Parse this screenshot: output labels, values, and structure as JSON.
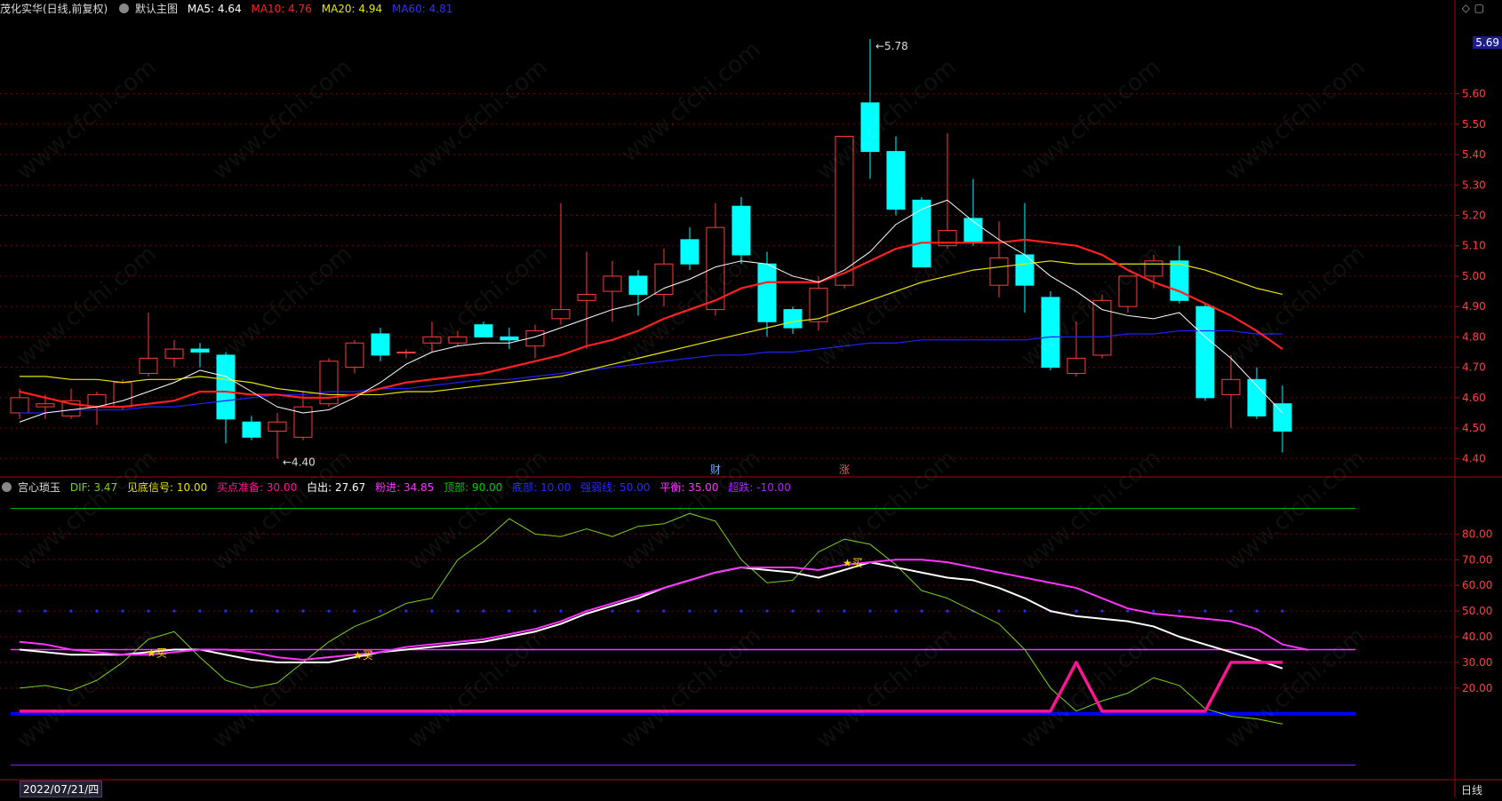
{
  "header_main": {
    "title": "茂化实华(日线,前复权)",
    "indicator_name": "默认主图",
    "ma5": "MA5: 4.64",
    "ma10": "MA10: 4.76",
    "ma20": "MA20: 4.94",
    "ma60": "MA60: 4.81"
  },
  "header_sub": {
    "indicator_name": "宫心琐玉",
    "dif": "DIF: 3.47",
    "signal_bottom": "见底信号: 10.00",
    "buy_ready": "买点准备: 30.00",
    "white_out": "白出: 27.67",
    "pink_in": "粉进: 34.85",
    "top": "顶部: 90.00",
    "bottom": "底部: 10.00",
    "strong_weak": "强弱线: 50.00",
    "balance": "平衡: 35.00",
    "oversold": "超跌: -10.00"
  },
  "last_price": "5.69",
  "date_label": "2022/07/21/四",
  "period_label": "日线",
  "colors": {
    "up": "#ff3c3c",
    "down": "#00ffff",
    "ma5": "#ffffff",
    "ma10": "#ff2020",
    "ma20": "#e6e600",
    "ma60": "#2020ff",
    "dif": "#7ad11c",
    "white": "#ffffff",
    "pink": "#ff33ff",
    "magenta": "#ff1493",
    "blue": "#0000ff",
    "green_line": "#00b000"
  },
  "watermark": "www.cfchi.com",
  "chart_data": [
    {
      "type": "candlestick",
      "title": "茂化实华(日线,前复权)",
      "ylim": [
        4.36,
        5.85
      ],
      "yticks": [
        "5.60",
        "5.50",
        "5.40",
        "5.30",
        "5.20",
        "5.10",
        "5.00",
        "4.90",
        "4.80",
        "4.70",
        "4.60",
        "4.50",
        "4.40"
      ],
      "candles": [
        {
          "o": 4.55,
          "h": 4.63,
          "l": 4.53,
          "c": 4.6
        },
        {
          "o": 4.57,
          "h": 4.61,
          "l": 4.53,
          "c": 4.58
        },
        {
          "o": 4.54,
          "h": 4.63,
          "l": 4.53,
          "c": 4.59
        },
        {
          "o": 4.57,
          "h": 4.62,
          "l": 4.51,
          "c": 4.61
        },
        {
          "o": 4.57,
          "h": 4.66,
          "l": 4.56,
          "c": 4.65
        },
        {
          "o": 4.68,
          "h": 4.88,
          "l": 4.67,
          "c": 4.73
        },
        {
          "o": 4.73,
          "h": 4.79,
          "l": 4.7,
          "c": 4.76
        },
        {
          "o": 4.76,
          "h": 4.78,
          "l": 4.7,
          "c": 4.75
        },
        {
          "o": 4.74,
          "h": 4.75,
          "l": 4.45,
          "c": 4.53
        },
        {
          "o": 4.52,
          "h": 4.54,
          "l": 4.46,
          "c": 4.47
        },
        {
          "o": 4.49,
          "h": 4.55,
          "l": 4.4,
          "c": 4.52
        },
        {
          "o": 4.47,
          "h": 4.62,
          "l": 4.46,
          "c": 4.57
        },
        {
          "o": 4.58,
          "h": 4.73,
          "l": 4.57,
          "c": 4.72
        },
        {
          "o": 4.7,
          "h": 4.79,
          "l": 4.68,
          "c": 4.78
        },
        {
          "o": 4.81,
          "h": 4.83,
          "l": 4.72,
          "c": 4.74
        },
        {
          "o": 4.75,
          "h": 4.76,
          "l": 4.73,
          "c": 4.75
        },
        {
          "o": 4.78,
          "h": 4.85,
          "l": 4.75,
          "c": 4.8
        },
        {
          "o": 4.78,
          "h": 4.82,
          "l": 4.77,
          "c": 4.8
        },
        {
          "o": 4.84,
          "h": 4.85,
          "l": 4.8,
          "c": 4.8
        },
        {
          "o": 4.8,
          "h": 4.83,
          "l": 4.76,
          "c": 4.79
        },
        {
          "o": 4.77,
          "h": 4.84,
          "l": 4.73,
          "c": 4.82
        },
        {
          "o": 4.86,
          "h": 5.24,
          "l": 4.84,
          "c": 4.89
        },
        {
          "o": 4.92,
          "h": 5.08,
          "l": 4.76,
          "c": 4.94
        },
        {
          "o": 4.95,
          "h": 5.05,
          "l": 4.85,
          "c": 5.0
        },
        {
          "o": 5.0,
          "h": 5.02,
          "l": 4.87,
          "c": 4.94
        },
        {
          "o": 4.94,
          "h": 5.09,
          "l": 4.9,
          "c": 5.04
        },
        {
          "o": 5.12,
          "h": 5.16,
          "l": 5.02,
          "c": 5.04
        },
        {
          "o": 4.89,
          "h": 5.24,
          "l": 4.87,
          "c": 5.16
        },
        {
          "o": 5.23,
          "h": 5.26,
          "l": 5.04,
          "c": 5.07
        },
        {
          "o": 5.04,
          "h": 5.08,
          "l": 4.8,
          "c": 4.85
        },
        {
          "o": 4.89,
          "h": 4.9,
          "l": 4.81,
          "c": 4.83
        },
        {
          "o": 4.85,
          "h": 5.0,
          "l": 4.82,
          "c": 4.96
        },
        {
          "o": 4.97,
          "h": 5.46,
          "l": 4.96,
          "c": 5.46
        },
        {
          "o": 5.57,
          "h": 5.78,
          "l": 5.32,
          "c": 5.41
        },
        {
          "o": 5.41,
          "h": 5.46,
          "l": 5.2,
          "c": 5.22
        },
        {
          "o": 5.25,
          "h": 5.26,
          "l": 5.03,
          "c": 5.03
        },
        {
          "o": 5.1,
          "h": 5.47,
          "l": 5.09,
          "c": 5.15
        },
        {
          "o": 5.19,
          "h": 5.32,
          "l": 5.1,
          "c": 5.11
        },
        {
          "o": 4.97,
          "h": 5.18,
          "l": 4.93,
          "c": 5.06
        },
        {
          "o": 5.07,
          "h": 5.24,
          "l": 4.88,
          "c": 4.97
        },
        {
          "o": 4.93,
          "h": 4.95,
          "l": 4.69,
          "c": 4.7
        },
        {
          "o": 4.68,
          "h": 4.85,
          "l": 4.67,
          "c": 4.73
        },
        {
          "o": 4.74,
          "h": 4.94,
          "l": 4.73,
          "c": 4.92
        },
        {
          "o": 4.9,
          "h": 5.0,
          "l": 4.88,
          "c": 5.0
        },
        {
          "o": 5.0,
          "h": 5.07,
          "l": 4.96,
          "c": 5.05
        },
        {
          "o": 5.05,
          "h": 5.1,
          "l": 4.91,
          "c": 4.92
        },
        {
          "o": 4.9,
          "h": 4.91,
          "l": 4.59,
          "c": 4.6
        },
        {
          "o": 4.61,
          "h": 4.74,
          "l": 4.5,
          "c": 4.66
        },
        {
          "o": 4.66,
          "h": 4.7,
          "l": 4.53,
          "c": 4.54
        },
        {
          "o": 4.58,
          "h": 4.64,
          "l": 4.42,
          "c": 4.49
        }
      ],
      "ma5": [
        4.52,
        4.55,
        4.56,
        4.57,
        4.59,
        4.62,
        4.65,
        4.69,
        4.67,
        4.62,
        4.57,
        4.55,
        4.56,
        4.6,
        4.65,
        4.71,
        4.75,
        4.77,
        4.78,
        4.78,
        4.8,
        4.83,
        4.86,
        4.89,
        4.91,
        4.96,
        4.99,
        5.03,
        5.05,
        5.04,
        5.0,
        4.98,
        5.02,
        5.08,
        5.17,
        5.22,
        5.25,
        5.18,
        5.12,
        5.07,
        5.0,
        4.95,
        4.89,
        4.87,
        4.86,
        4.88,
        4.8,
        4.73,
        4.64,
        4.55
      ],
      "ma10": [
        4.62,
        4.6,
        4.58,
        4.57,
        4.57,
        4.58,
        4.59,
        4.62,
        4.62,
        4.61,
        4.61,
        4.6,
        4.6,
        4.61,
        4.63,
        4.65,
        4.66,
        4.67,
        4.68,
        4.7,
        4.72,
        4.74,
        4.77,
        4.79,
        4.82,
        4.86,
        4.89,
        4.92,
        4.96,
        4.98,
        4.98,
        4.98,
        5.01,
        5.05,
        5.09,
        5.11,
        5.11,
        5.11,
        5.11,
        5.12,
        5.11,
        5.1,
        5.07,
        5.02,
        4.98,
        4.95,
        4.91,
        4.87,
        4.82,
        4.76
      ],
      "ma20": [
        4.67,
        4.67,
        4.66,
        4.66,
        4.65,
        4.66,
        4.66,
        4.67,
        4.66,
        4.65,
        4.63,
        4.62,
        4.61,
        4.61,
        4.61,
        4.62,
        4.62,
        4.63,
        4.64,
        4.65,
        4.66,
        4.67,
        4.69,
        4.71,
        4.73,
        4.75,
        4.77,
        4.79,
        4.81,
        4.83,
        4.85,
        4.86,
        4.89,
        4.92,
        4.95,
        4.98,
        5.0,
        5.02,
        5.03,
        5.04,
        5.05,
        5.04,
        5.04,
        5.04,
        5.04,
        5.04,
        5.02,
        4.99,
        4.96,
        4.94
      ],
      "ma60": [
        4.55,
        4.55,
        4.56,
        4.56,
        4.56,
        4.57,
        4.57,
        4.58,
        4.59,
        4.6,
        4.61,
        4.61,
        4.62,
        4.62,
        4.63,
        4.63,
        4.64,
        4.65,
        4.66,
        4.66,
        4.67,
        4.68,
        4.69,
        4.7,
        4.71,
        4.72,
        4.73,
        4.74,
        4.74,
        4.75,
        4.75,
        4.76,
        4.77,
        4.78,
        4.78,
        4.79,
        4.79,
        4.79,
        4.79,
        4.79,
        4.8,
        4.8,
        4.8,
        4.81,
        4.81,
        4.82,
        4.82,
        4.82,
        4.81,
        4.81
      ],
      "annotations": [
        {
          "label": "5.78",
          "index": 33,
          "value": 5.78
        },
        {
          "label": "4.40",
          "index": 10,
          "value": 4.4
        },
        {
          "label": "财",
          "index": 27
        },
        {
          "label": "涨",
          "index": 32
        }
      ]
    },
    {
      "type": "line",
      "title": "宫心琐玉",
      "ylim": [
        -15,
        95
      ],
      "yticks": [
        "80.00",
        "70.00",
        "60.00",
        "50.00",
        "40.00",
        "30.00",
        "20.00"
      ],
      "series": [
        {
          "name": "DIF",
          "values": [
            20,
            21,
            19,
            23,
            30,
            39,
            42,
            32,
            23,
            20,
            22,
            30,
            38,
            44,
            48,
            53,
            55,
            70,
            77,
            86,
            80,
            79,
            82,
            79,
            83,
            84,
            88,
            85,
            70,
            61,
            62,
            73,
            78,
            76,
            68,
            58,
            55,
            50,
            45,
            35,
            20,
            11,
            15,
            18,
            24,
            21,
            12,
            9,
            8,
            6
          ]
        },
        {
          "name": "白出",
          "values": [
            35,
            34,
            33,
            33,
            33,
            34,
            35,
            35,
            33,
            31,
            30,
            30,
            30,
            32,
            34,
            35,
            36,
            37,
            38,
            40,
            42,
            45,
            49,
            52,
            55,
            59,
            62,
            65,
            67,
            66,
            65,
            63,
            66,
            69,
            67,
            65,
            63,
            62,
            59,
            55,
            50,
            48,
            47,
            46,
            44,
            40,
            37,
            34,
            31,
            27.67
          ]
        },
        {
          "name": "粉进",
          "values": [
            38,
            37,
            35,
            34,
            33,
            33,
            34,
            35,
            35,
            34,
            32,
            31,
            32,
            33,
            34,
            36,
            37,
            38,
            39,
            41,
            43,
            46,
            50,
            53,
            56,
            59,
            62,
            65,
            67,
            67,
            67,
            66,
            68,
            69,
            70,
            70,
            69,
            67,
            65,
            63,
            61,
            59,
            55,
            51,
            49,
            48,
            47,
            46,
            43,
            37,
            34.85
          ]
        },
        {
          "name": "买点准备",
          "values": [
            11,
            11,
            11,
            11,
            11,
            11,
            11,
            11,
            11,
            11,
            11,
            11,
            11,
            11,
            11,
            11,
            11,
            11,
            11,
            11,
            11,
            11,
            11,
            11,
            11,
            11,
            11,
            11,
            11,
            11,
            11,
            11,
            11,
            11,
            11,
            11,
            11,
            11,
            11,
            11,
            11,
            30,
            11,
            11,
            11,
            11,
            11,
            30,
            30,
            30
          ]
        }
      ],
      "levels": {
        "top": 90,
        "strong_weak": 50,
        "balance": 35,
        "bottom": 10,
        "oversold": -10
      },
      "buy_marks": [
        {
          "label": "买",
          "index": 5,
          "value": 34
        },
        {
          "label": "买",
          "index": 13,
          "value": 33
        },
        {
          "label": "买",
          "index": 32,
          "value": 69
        }
      ]
    }
  ]
}
